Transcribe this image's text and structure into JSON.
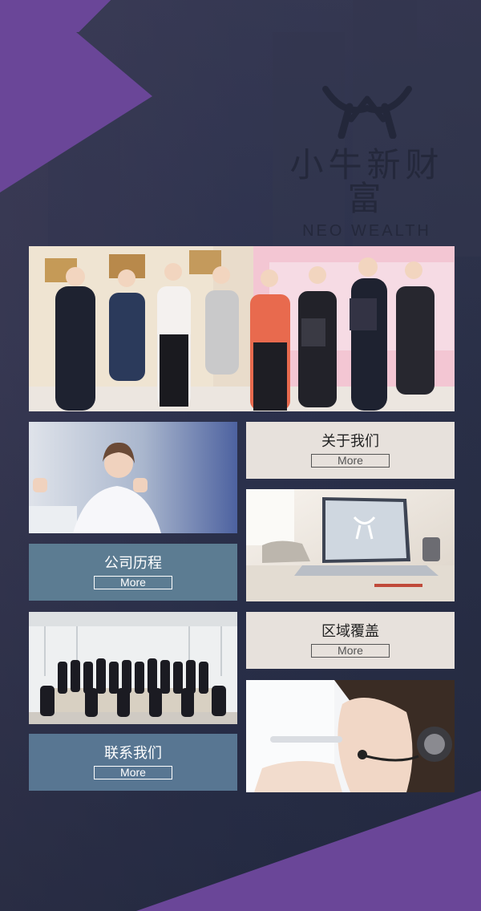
{
  "brand": {
    "name_cn": "小牛新财富",
    "name_en": "NEO WEALTH",
    "accent": "#6a4698"
  },
  "cards": [
    {
      "title": "关于我们",
      "more": "More"
    },
    {
      "title": "公司历程",
      "more": "More"
    },
    {
      "title": "区域覆盖",
      "more": "More"
    },
    {
      "title": "联系我们",
      "more": "More"
    }
  ],
  "photos": {
    "award": "award-ceremony-photo",
    "office_woman": "thumbs-up-woman-photo",
    "laptop": "laptop-desk-photo",
    "team": "team-group-photo",
    "headset": "customer-service-photo"
  }
}
